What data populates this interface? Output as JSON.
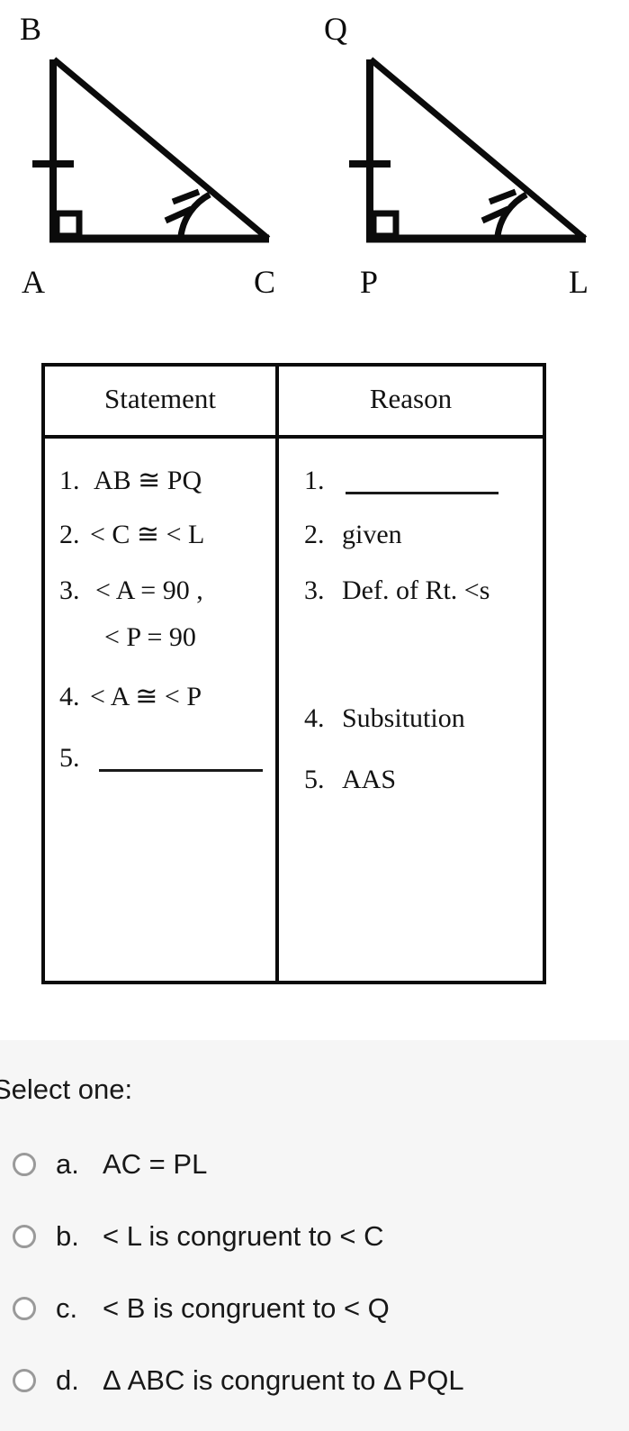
{
  "figure": {
    "caption_icons": "two-congruent-right-triangles",
    "triangles": [
      {
        "name": "triangle-abc",
        "vertices": [
          {
            "label": "B",
            "role": "apex"
          },
          {
            "label": "A",
            "role": "right-angle"
          },
          {
            "label": "C",
            "role": "marked-angle"
          }
        ],
        "marks": {
          "right_angle_at": "A",
          "single_tick_on": "AB",
          "double_arc_at": "C"
        }
      },
      {
        "name": "triangle-pql",
        "vertices": [
          {
            "label": "Q",
            "role": "apex"
          },
          {
            "label": "P",
            "role": "right-angle"
          },
          {
            "label": "L",
            "role": "marked-angle"
          }
        ],
        "marks": {
          "right_angle_at": "P",
          "single_tick_on": "PQ",
          "double_arc_at": "L"
        }
      }
    ]
  },
  "proof_table": {
    "headers": [
      "Statement",
      "Reason"
    ],
    "rows": [
      {
        "statement_num": "1.",
        "statement": "AB ≅ PQ",
        "statement_blank": false,
        "reason_num": "1.",
        "reason": "",
        "reason_blank": true
      },
      {
        "statement_num": "2.",
        "statement": "< C ≅ < L",
        "statement_blank": false,
        "reason_num": "2.",
        "reason": "given",
        "reason_blank": false
      },
      {
        "statement_num": "3.",
        "statement": "< A = 90 ,",
        "statement_line2": "< P = 90",
        "statement_blank": false,
        "reason_num": "3.",
        "reason": "Def. of Rt. <s",
        "reason_blank": false
      },
      {
        "statement_num": "4.",
        "statement": "< A ≅ < P",
        "statement_blank": false,
        "reason_num": "4.",
        "reason": "Subsitution",
        "reason_blank": false
      },
      {
        "statement_num": "5.",
        "statement": "",
        "statement_blank": true,
        "reason_num": "5.",
        "reason": "AAS",
        "reason_blank": false
      }
    ]
  },
  "answer": {
    "prompt": "Select one:",
    "options": [
      {
        "letter": "a.",
        "text": "AC = PL",
        "selected": false
      },
      {
        "letter": "b.",
        "text": "< L is congruent to < C",
        "selected": false
      },
      {
        "letter": "c.",
        "text": "< B is congruent to < Q",
        "selected": false
      },
      {
        "letter": "d.",
        "text": "Δ ABC is congruent to Δ PQL",
        "selected": false
      }
    ]
  },
  "colors": {
    "page_background": "#ffffff",
    "answer_background": "#f6f6f6",
    "ink": "#0b0b0b",
    "radio_border": "#9a9a9a"
  }
}
